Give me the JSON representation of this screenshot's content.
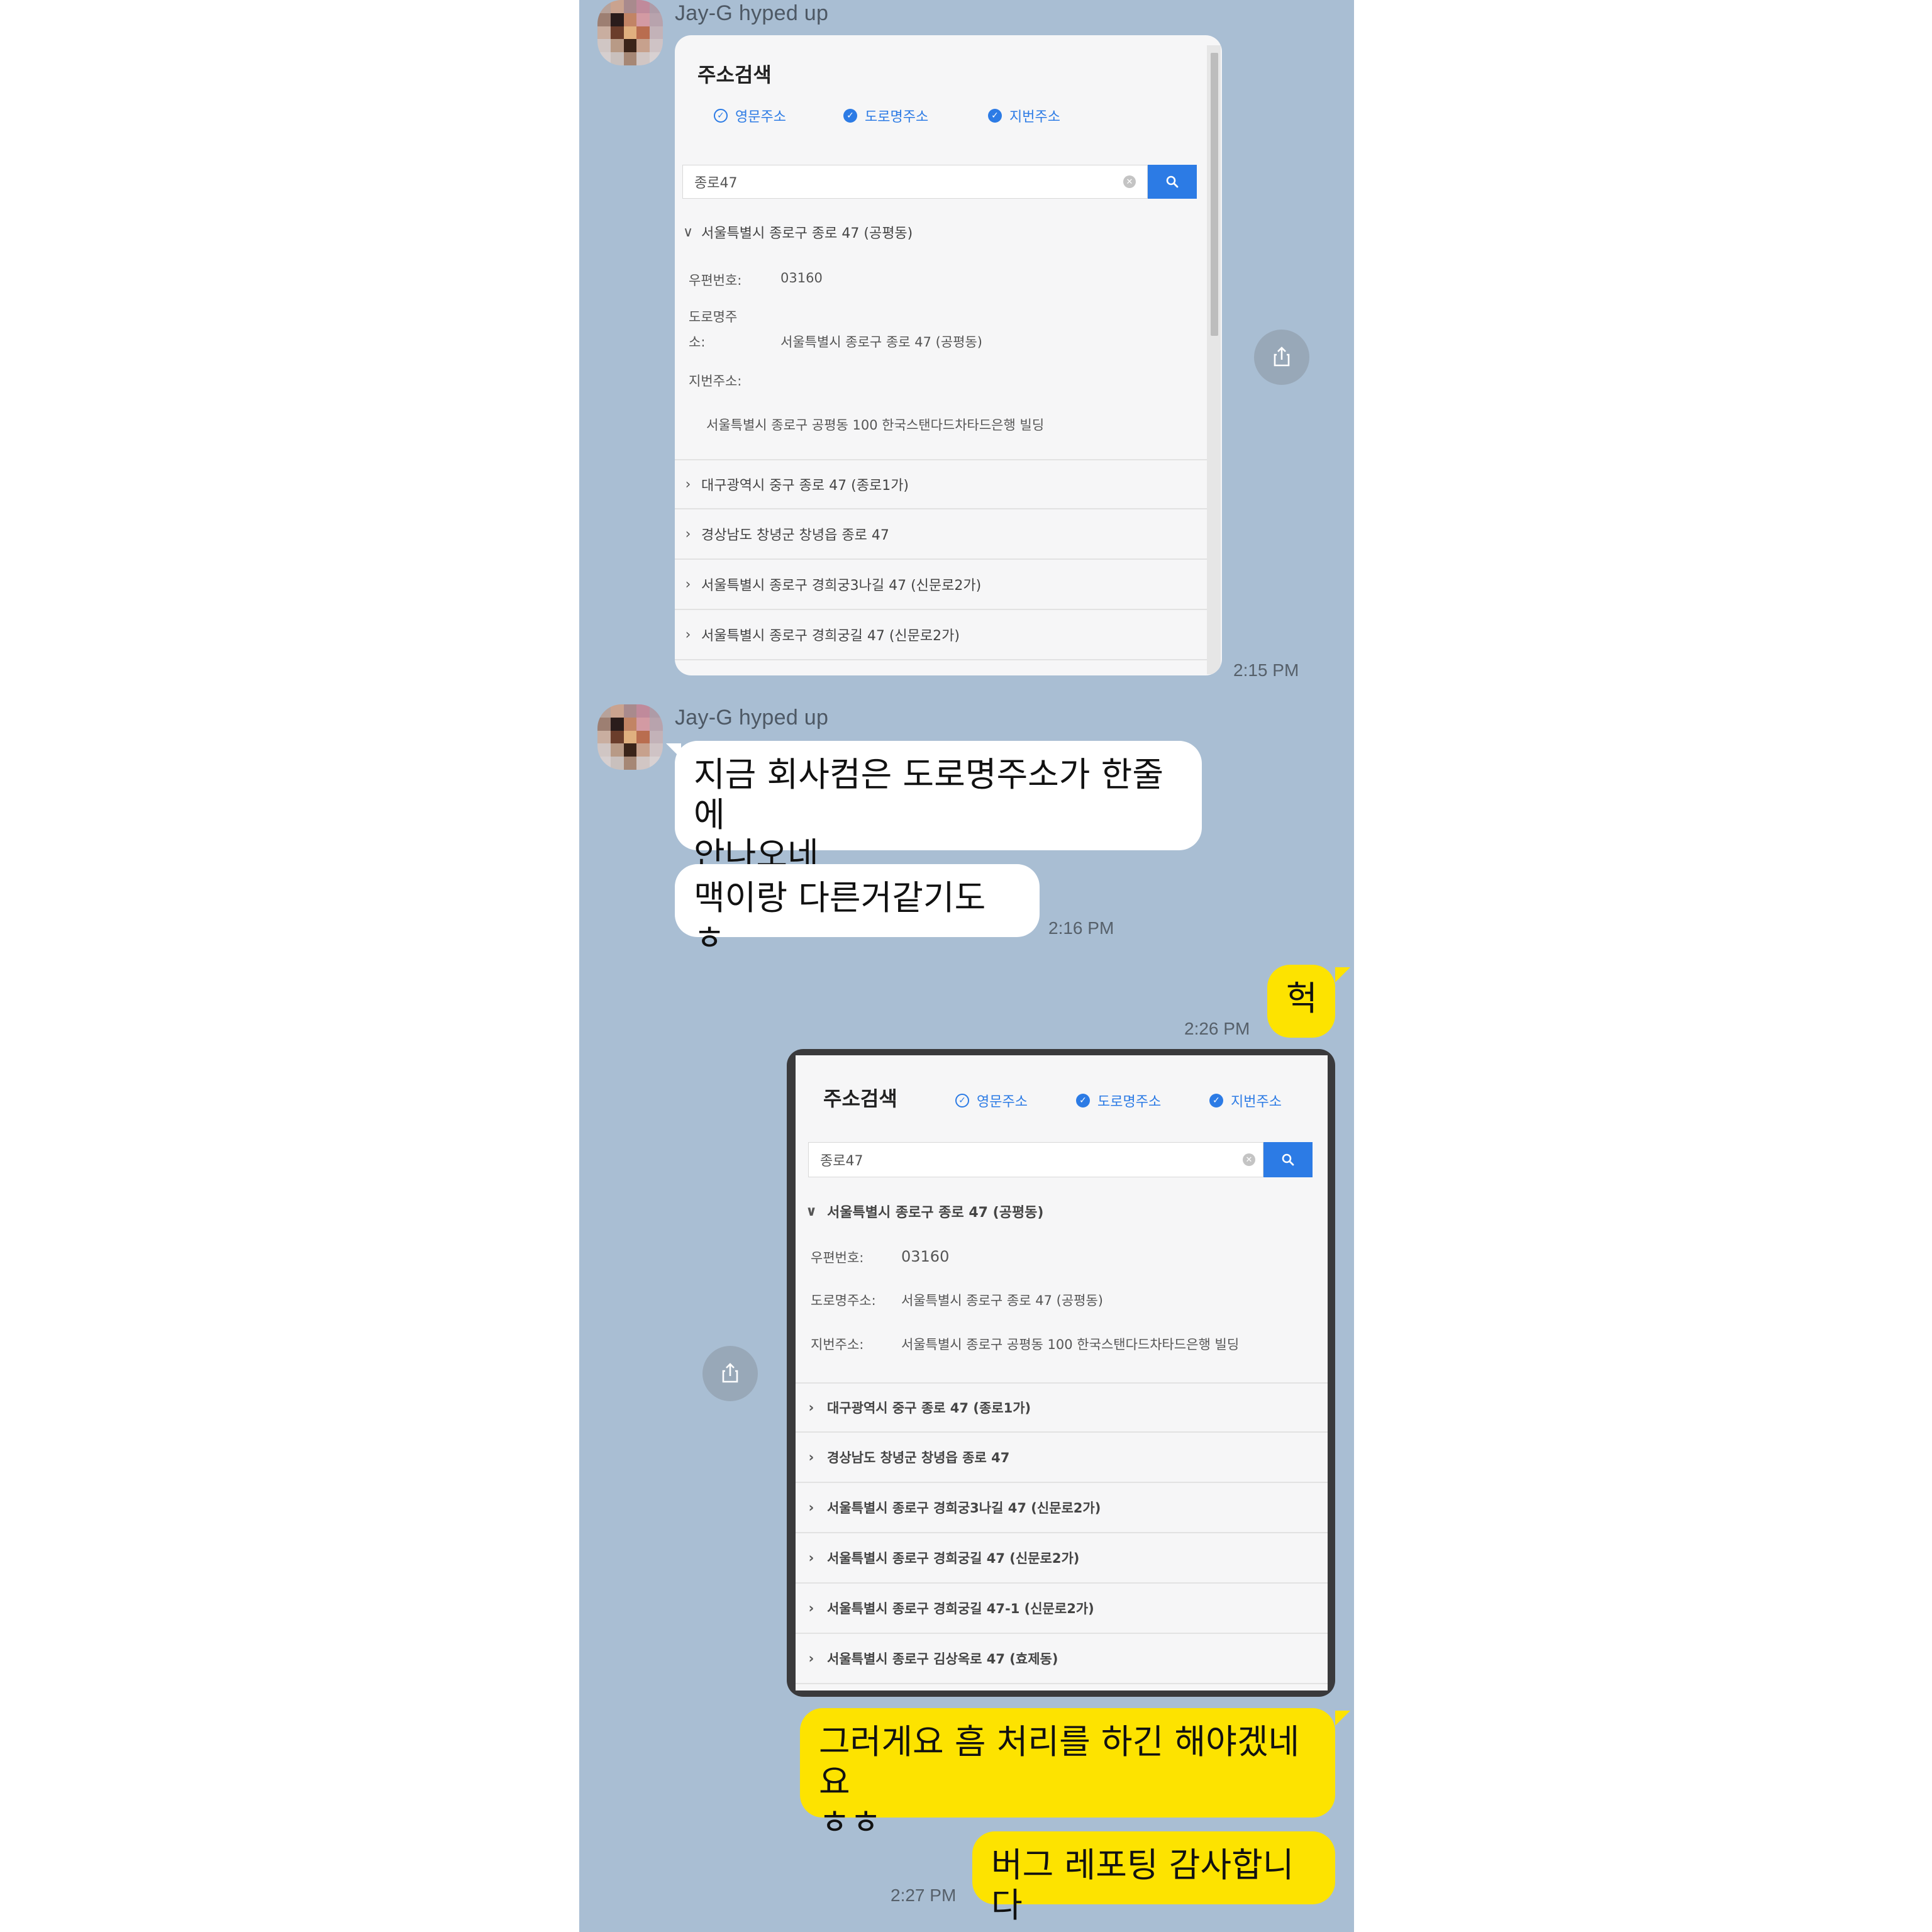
{
  "conversation": {
    "sender_name": "Jay-G hyped up",
    "msg1": {
      "time": "2:15 PM"
    },
    "msg2": {
      "line1": "지금 회사컴은 도로명주소가 한줄에",
      "line2": "안나오네"
    },
    "msg3": {
      "text": "맥이랑 다른거같기도 ㅎ",
      "time": "2:16 PM"
    },
    "msg4": {
      "text": "헉",
      "time": "2:26 PM"
    },
    "msg6": {
      "line1": "그러게요 흠 처리를 하긴 해야겠네요",
      "line2": "ㅎㅎ"
    },
    "msg7": {
      "text": "버그 레포팅 감사합니다",
      "time": "2:27 PM"
    }
  },
  "screenshot1": {
    "title": "주소검색",
    "radios": [
      "영문주소",
      "도로명주소",
      "지번주소"
    ],
    "search_value": "종로47",
    "expanded": {
      "label": "서울특별시 종로구 종로 47 (공평동)",
      "zip_label": "우편번호:",
      "zip_value": "03160",
      "road_label_l1": "도로명주",
      "road_label_l2": "소:",
      "road_value": "서울특별시 종로구 종로 47 (공평동)",
      "jibun_label": "지번주소:",
      "jibun_value": "서울특별시 종로구 공평동 100 한국스탠다드차타드은행 빌딩"
    },
    "results": [
      "대구광역시 중구 종로 47 (종로1가)",
      "경상남도 창녕군 창녕읍 종로 47",
      "서울특별시 종로구 경희궁3나길 47 (신문로2가)",
      "서울특별시 종로구 경희궁길 47 (신문로2가)"
    ]
  },
  "screenshot2": {
    "title": "주소검색",
    "radios": [
      "영문주소",
      "도로명주소",
      "지번주소"
    ],
    "search_value": "종로47",
    "expanded": {
      "label": "서울특별시 종로구 종로 47 (공평동)",
      "zip_label": "우편번호:",
      "zip_value": "03160",
      "road_label": "도로명주소:",
      "road_value": "서울특별시 종로구 종로 47 (공평동)",
      "jibun_label": "지번주소:",
      "jibun_value": "서울특별시 종로구 공평동 100 한국스탠다드차타드은행 빌딩"
    },
    "results": [
      "대구광역시 중구 종로 47 (종로1가)",
      "경상남도 창녕군 창녕읍 종로 47",
      "서울특별시 종로구 경희궁3나길 47 (신문로2가)",
      "서울특별시 종로구 경희궁길 47 (신문로2가)",
      "서울특별시 종로구 경희궁길 47-1 (신문로2가)",
      "서울특별시 종로구 김상옥로 47 (효제동)"
    ]
  },
  "icons": {
    "share": "share-icon",
    "search": "search-icon",
    "chevron": "chevron-icon",
    "clear": "clear-icon"
  }
}
